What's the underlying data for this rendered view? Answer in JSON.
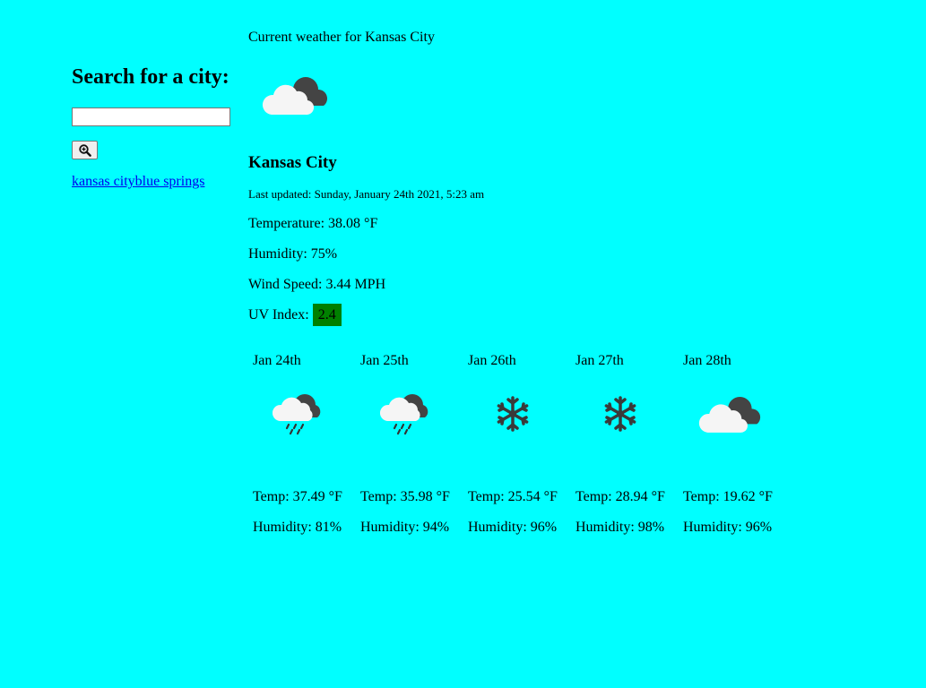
{
  "sidebar": {
    "heading": "Search for a city:",
    "input_value": "",
    "search_icon": "search-icon",
    "history": [
      "kansas city",
      "blue springs"
    ]
  },
  "current": {
    "label": "Current weather for Kansas City",
    "icon": "partly-cloudy-icon",
    "city": "Kansas City",
    "updated": "Last updated: Sunday, January 24th 2021, 5:23 am",
    "temperature": "Temperature: 38.08 °F",
    "humidity": "Humidity: 75%",
    "wind": "Wind Speed: 3.44 MPH",
    "uv_label": "UV Index:",
    "uv_value": "2.4",
    "uv_color": "#008000"
  },
  "forecast": [
    {
      "date": "Jan 24th",
      "icon": "rain-icon",
      "temp": "Temp: 37.49 °F",
      "humidity": "Humidity: 81%"
    },
    {
      "date": "Jan 25th",
      "icon": "rain-icon",
      "temp": "Temp: 35.98 °F",
      "humidity": "Humidity: 94%"
    },
    {
      "date": "Jan 26th",
      "icon": "snow-icon",
      "temp": "Temp: 25.54 °F",
      "humidity": "Humidity: 96%"
    },
    {
      "date": "Jan 27th",
      "icon": "snow-icon",
      "temp": "Temp: 28.94 °F",
      "humidity": "Humidity: 98%"
    },
    {
      "date": "Jan 28th",
      "icon": "partly-cloudy-icon",
      "temp": "Temp: 19.62 °F",
      "humidity": "Humidity: 96%"
    }
  ],
  "colors": {
    "background": "#00ffff",
    "link": "#0000ee"
  }
}
